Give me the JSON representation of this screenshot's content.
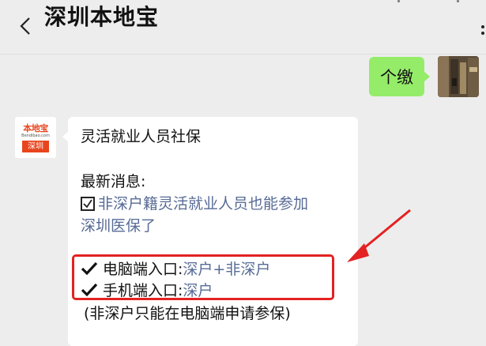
{
  "header": {
    "title": "深圳本地宝"
  },
  "outgoing": {
    "text": "个缴"
  },
  "incoming": {
    "avatar_logo": "本地宝",
    "avatar_url": "Bendibao.com",
    "avatar_city": "深圳",
    "heading": "灵活就业人员社保",
    "news_label": "最新消息:",
    "news_link_line1": "非深户籍灵活就业人员也能参加",
    "news_link_line2": "深圳医保了",
    "entry_pc_label": "电脑端入口:",
    "entry_pc_value": "深户+非深户",
    "entry_mobile_label": "手机端入口:",
    "entry_mobile_value": "深户",
    "note": "(非深户只能在电脑端申请参保)"
  },
  "colors": {
    "link": "#576b95",
    "outgoing_bubble": "#95ec69",
    "highlight": "#e32222"
  }
}
